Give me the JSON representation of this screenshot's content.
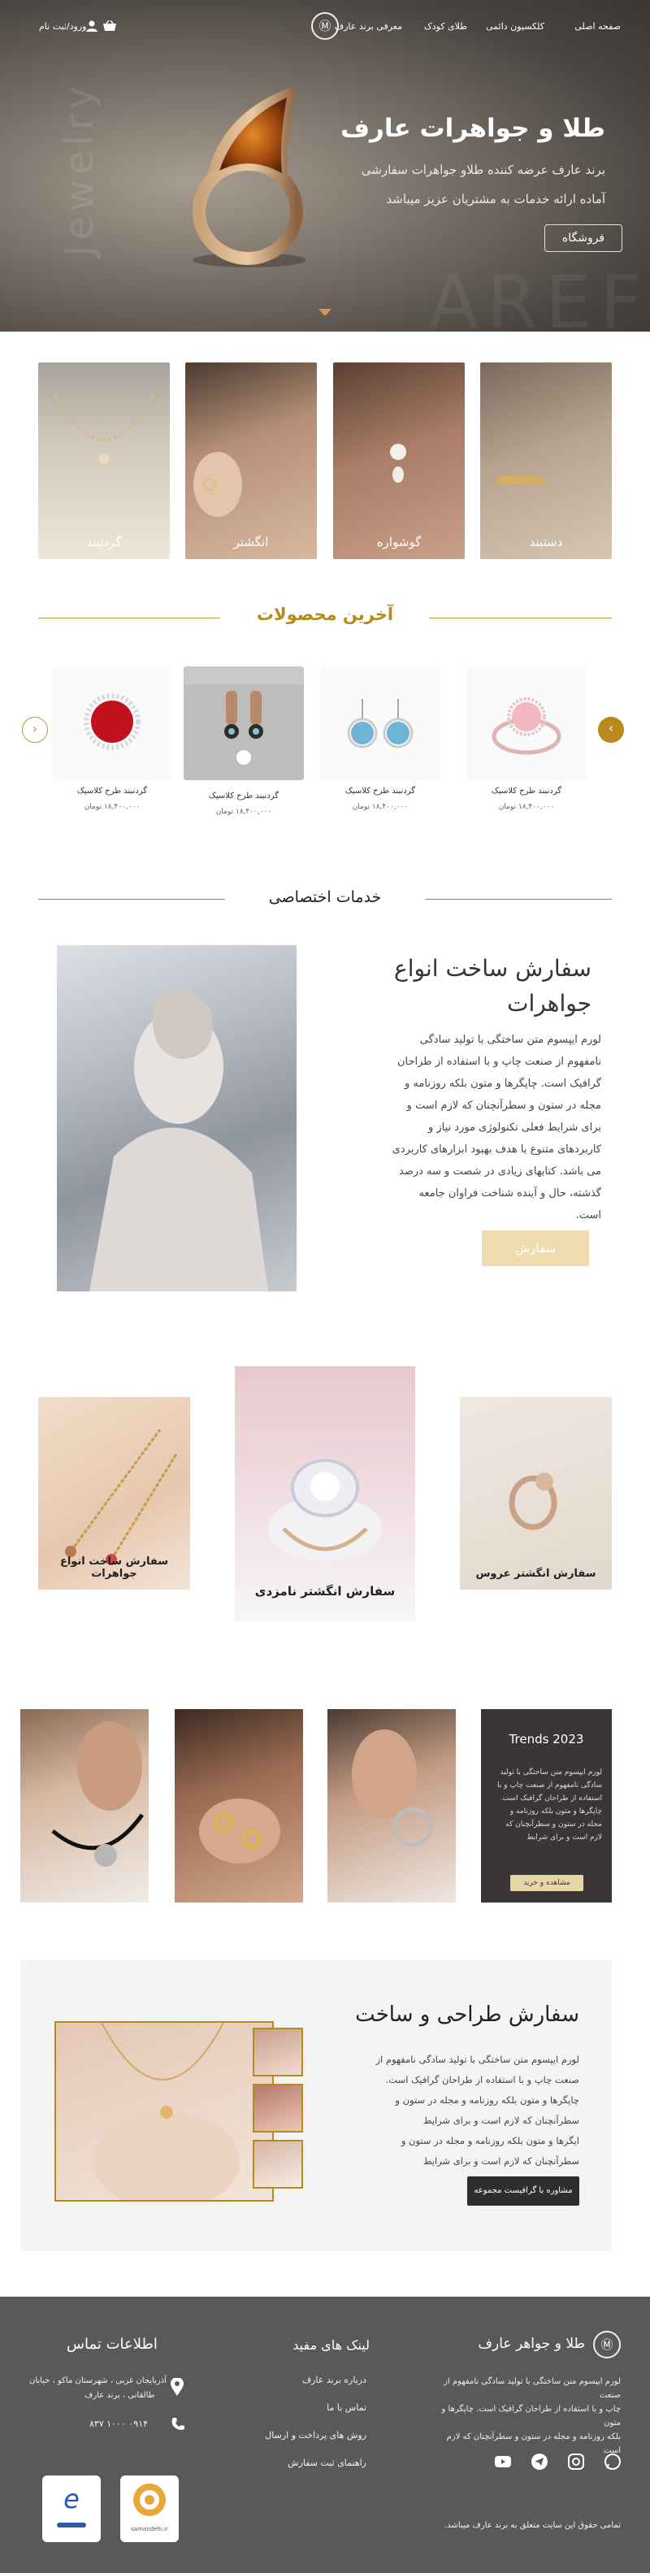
{
  "header": {
    "nav": [
      "صفحه اصلی",
      "کلکسیون دائمی",
      "طلای کودک",
      "معرفی برند عارف"
    ],
    "login_label": "ورود/ثبت نام",
    "logo_text": "Ⓜ",
    "cart_icon": "basket-icon",
    "user_icon": "user-icon"
  },
  "hero": {
    "title": "طلا و جواهرات عارف",
    "subtitle_line1": "برند عارف عرضه کننده طلاو جواهرات سفارشی",
    "subtitle_line2": "آماده ارائه خدمات به مشتریان عزیز میباشد",
    "button_label": "فروشگاه",
    "watermark_vertical": "Jewelry",
    "watermark_bottom": "AREF"
  },
  "categories": [
    "دستبند",
    "گوشواره",
    "انگشتر",
    "گردنبند"
  ],
  "latest": {
    "title": "آخرین محصولات",
    "products": [
      {
        "name": "گردنبند طرح کلاسیک",
        "price": "۱۸,۴۰۰,۰۰۰",
        "currency": "تومان"
      },
      {
        "name": "گردنبند طرح کلاسیک",
        "price": "۱۸,۴۰۰,۰۰۰",
        "currency": "تومان"
      },
      {
        "name": "گردنبند طرح کلاسیک",
        "price": "۱۸,۴۰۰,۰۰۰",
        "currency": "تومان"
      },
      {
        "name": "گردنبند طرح کلاسیک",
        "price": "۱۸,۴۰۰,۰۰۰",
        "currency": "تومان"
      }
    ],
    "prev_icon": "chevron-left-icon",
    "next_icon": "chevron-right-icon"
  },
  "services": {
    "title": "خدمات اختصاصی",
    "heading_line1": "سفارش ساخت انواع",
    "heading_line2": "جواهرات",
    "body": [
      "لورم ایپسوم متن ساختگی با تولید سادگی",
      "نامفهوم از صنعت چاپ و با استفاده از طراحان",
      "گرافیک است. چاپگرها و متون بلکه روزنامه و",
      "مجله در ستون و سطرآنچنان که لازم است و",
      "برای شرایط فعلی تکنولوژی مورد نیاز و",
      "کاربردهای متنوع با هدف بهبود ابزارهای کاربردی",
      "می باشد. کتابهای زیادی در شصت و سه درصد",
      "گذشته، حال و آینده شناخت فراوان جامعه",
      "است."
    ],
    "order_button": "سفارش"
  },
  "features": [
    {
      "label": "سفارش انگشتر عروس"
    },
    {
      "label": "سفارش انگشتر نامزدی"
    },
    {
      "label": "سفارش ساخت انواع جواهرات"
    }
  ],
  "trends": {
    "title": "2023 Trends",
    "body": [
      "لورم ایپسوم متن ساختگی با تولید",
      "سادگی نامفهوم از صنعت چاپ و با",
      "استفاده از طراحان گرافیک است.",
      "چاپگرها و متون بلکه روزنامه و",
      "مجله در ستون و سطرآنچنان که",
      "لازم است و برای شرایط"
    ],
    "button": "مشاهده و خرید"
  },
  "design": {
    "title": "سفارش طراحی و ساخت",
    "body": [
      "لورم ایپسوم متن ساختگی با تولید سادگی نامفهوم از",
      "صنعت چاپ و با استفاده از طراحان گرافیک است.",
      "چاپگرها و متون بلکه روزنامه و مجله در ستون و",
      "سطرآنچنان که لازم است و برای شرایط",
      "ایگرها و متون بلکه روزنامه و مجله در ستون و",
      "سطرآنچنان که لازم است و برای شرایط"
    ],
    "button": "مشاوره با گرافیست مجموعه"
  },
  "footer": {
    "brand": "طلا و جواهر عارف",
    "about": [
      "لورم ایپسوم متن ساختگی با تولید سادگی نامفهوم از صنعت",
      "چاپ و با استفاده از طراحان گرافیک است. چاپگرها و متون",
      "بلکه روزنامه و مجله در ستون و سطرآنچنان که لازم است"
    ],
    "useful_title": "لینک های مفید",
    "useful_links": [
      "درباره برند عارف",
      "تماس با ما",
      "روش های پرداخت و ارسال",
      "راهنمای ثبت سفارش"
    ],
    "contact_title": "اطلاعات تماس",
    "address_line1": "آذربایجان غربی ، شهرستان ماکو ، خیابان",
    "address_line2": "طالقانی ، برند عارف",
    "phone": "۰۹۱۴ ۱۰۰۰ ۸۳۷",
    "copyright": "تمامی حقوق این سایت متعلق به برند عارف میباشد.",
    "badge1_text": "e",
    "badge2_text": "samandehi.ir",
    "social_icons": [
      "whatsapp-icon",
      "instagram-icon",
      "telegram-icon",
      "youtube-icon"
    ]
  }
}
